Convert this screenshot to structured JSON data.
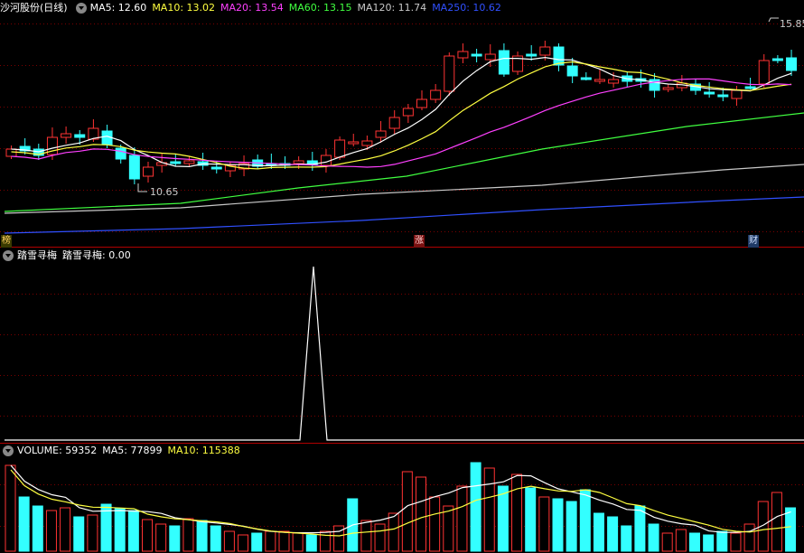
{
  "main_header": {
    "stock_title": "沙河股份(日线)",
    "ma_labels": [
      {
        "text": "MA5: 12.60",
        "color": "#ffffff"
      },
      {
        "text": "MA10: 13.02",
        "color": "#ffff40"
      },
      {
        "text": "MA20: 13.54",
        "color": "#ff40ff"
      },
      {
        "text": "MA60: 13.15",
        "color": "#40ff40"
      },
      {
        "text": "MA120: 11.74",
        "color": "#c8c8c8"
      },
      {
        "text": "MA250: 10.62",
        "color": "#3050ff"
      }
    ]
  },
  "price_annotations": {
    "high": "15.85",
    "low": "10.65"
  },
  "event_tags": {
    "left": "榜",
    "middle": "涨",
    "right": "财"
  },
  "indicator_header": {
    "name": "踏雪寻梅",
    "value_label": "踏雪寻梅: 0.00"
  },
  "volume_header": {
    "items": [
      {
        "text": "VOLUME: 59352",
        "color": "#ffffff"
      },
      {
        "text": "MA5: 77899",
        "color": "#ffffff"
      },
      {
        "text": "MA10: 115388",
        "color": "#ffff40"
      }
    ]
  },
  "colors": {
    "up": "#ff3333",
    "down": "#33ffff",
    "ma5": "#ffffff",
    "ma10": "#ffff40",
    "ma20": "#ff40ff",
    "ma60": "#40ff40",
    "ma120": "#c8c8c8",
    "ma250": "#3050ff",
    "separator": "#b00000",
    "grid": "#7a0000"
  }
}
